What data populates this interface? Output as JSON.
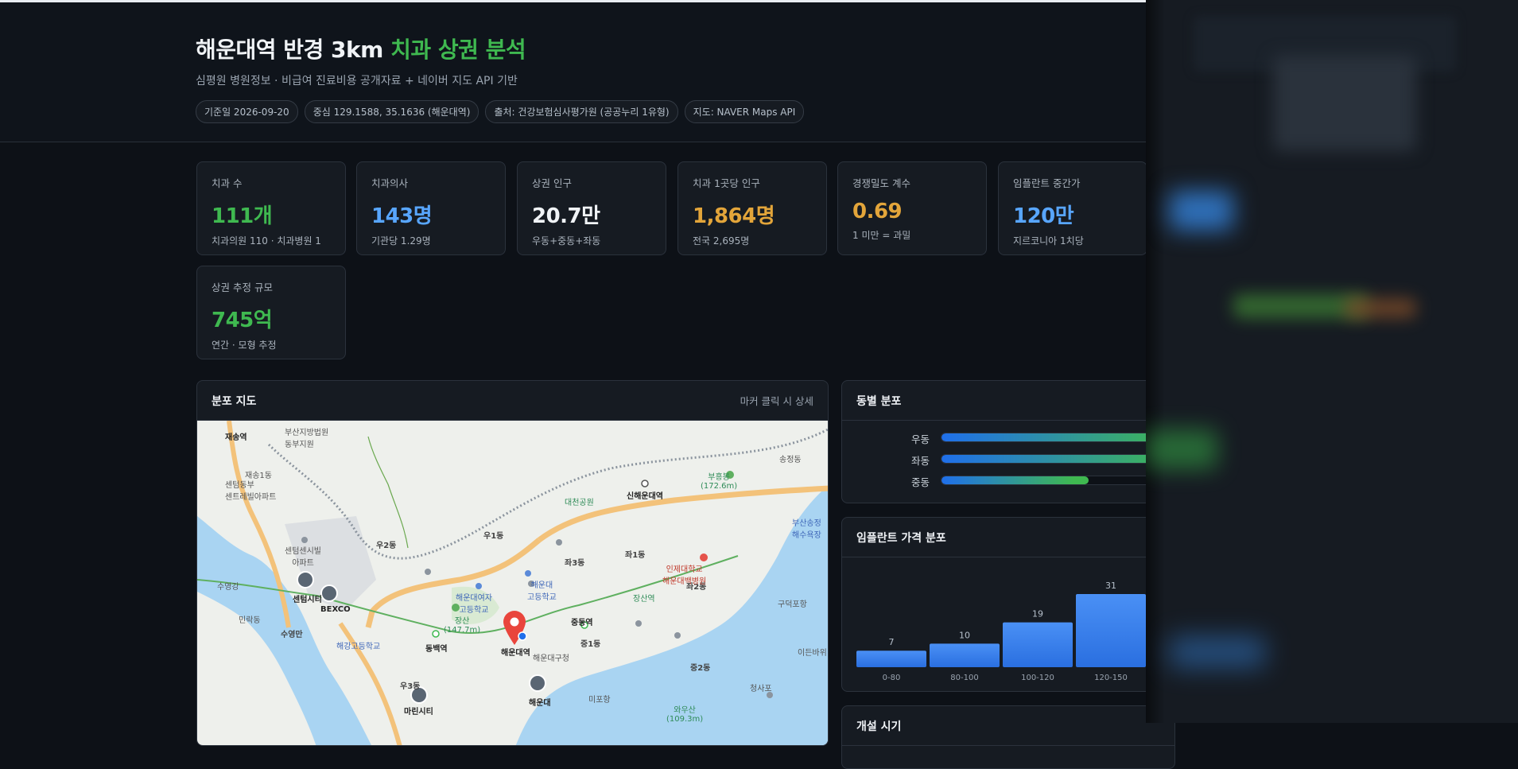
{
  "header": {
    "title_main": "해운대역 반경 3km",
    "title_accent": "치과 상권 분석",
    "subtitle": "심평원 병원정보 · 비급여 진료비용 공개자료 + 네이버 지도 API 기반",
    "chips": [
      "기준일 2026-09-20",
      "중심 129.1588, 35.1636 (해운대역)",
      "출처: 건강보험심사평가원 (공공누리 1유형)",
      "지도: NAVER Maps API"
    ]
  },
  "kpis": [
    {
      "label": "치과 수",
      "value": "111개",
      "sub": "치과의원 110 · 치과병원 1",
      "color": "#3fb950"
    },
    {
      "label": "치과의사",
      "value": "143명",
      "sub": "기관당 1.29명",
      "color": "#58a6ff"
    },
    {
      "label": "상권 인구",
      "value": "20.7만",
      "sub": "우동+중동+좌동",
      "color": "#f0f3f6"
    },
    {
      "label": "치과 1곳당 인구",
      "value": "1,864명",
      "sub": "전국 2,695명",
      "color": "#e3a53a"
    },
    {
      "label": "경쟁밀도 계수",
      "value": "0.69",
      "sub": "1 미만 = 과밀",
      "color": "#e3a53a"
    },
    {
      "label": "임플란트 중간가",
      "value": "120만",
      "sub": "지르코니아 1치당",
      "color": "#58a6ff"
    },
    {
      "label": "상권 추정 규모",
      "value": "745억",
      "sub": "연간 · 모형 추정",
      "color": "#3fb950"
    }
  ],
  "map_panel": {
    "title": "분포 지도",
    "hint": "마커 클릭 시 상세",
    "labels": {
      "l1": "재송역",
      "l2": "부산지방법원\n동부지원",
      "l3": "재송1동",
      "l4": "센텀동부\n센트레빌아파트",
      "l5": "우2동",
      "l6": "우1동",
      "l7": "좌1동",
      "l8": "좌3동",
      "l9": "좌2동",
      "l10": "중1동",
      "l11": "중2동",
      "l12": "우3동",
      "l13": "해운대역",
      "l14": "신해운대역",
      "l15": "송정동",
      "l16": "대천공원",
      "l17": "부흥봉\n(172.6m)",
      "l18": "장산역",
      "l19": "중동역",
      "l20": "동백역",
      "l21": "센텀시티",
      "l22": "BEXCO",
      "l23": "수영강",
      "l24": "민락동",
      "l25": "마린시티",
      "l26": "해운대",
      "l27": "미포항",
      "l28": "와우산\n(109.3m)",
      "l29": "청사포",
      "l30": "구덕포항",
      "l31": "인제대학교\n해운대백병원",
      "l32": "해운대여자\n고등학교",
      "l33": "해운대\n고등학교",
      "l34": "장산\n(147.7m)",
      "l35": "해운대구청",
      "l36": "이든바위",
      "l37": "부산송정\n해수욕장",
      "l38": "수영만",
      "l39": "센텀센시빌\n아파트",
      "l40": "해강고등학교"
    }
  },
  "dong_panel": {
    "title": "동별 분포",
    "rows": [
      {
        "name": "우동",
        "value": 1.0
      },
      {
        "name": "좌동",
        "value": 1.0
      },
      {
        "name": "중동",
        "value": 0.62
      }
    ]
  },
  "implant_panel": {
    "title": "임플란트 가격 분포"
  },
  "chart_data": {
    "type": "bar",
    "title": "임플란트 가격 분포",
    "categories": [
      "0-80",
      "80-100",
      "100-120",
      "120-150"
    ],
    "values": [
      7,
      10,
      19,
      31
    ],
    "ylim": [
      0,
      31
    ],
    "grid": false
  },
  "partial_panel": {
    "title": "개설 시기"
  },
  "colors": {
    "green": "#3fb950",
    "blue": "#58a6ff",
    "orange": "#e3a53a",
    "bar": "#2f81f7"
  }
}
